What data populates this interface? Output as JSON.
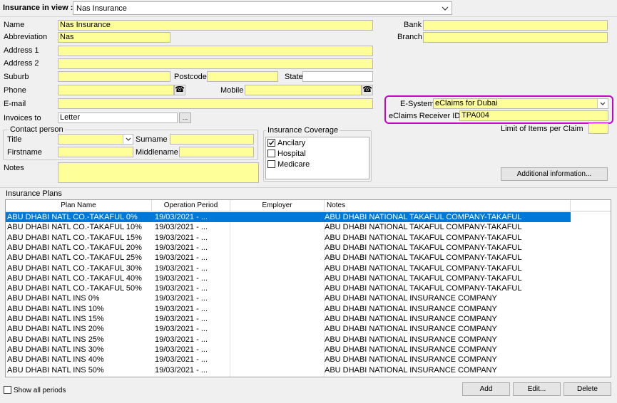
{
  "header": {
    "label": "Insurance in view :",
    "selected": "Nas Insurance"
  },
  "form": {
    "name_label": "Name",
    "name_value": "Nas Insurance",
    "abbr_label": "Abbreviation",
    "abbr_value": "Nas",
    "addr1_label": "Address 1",
    "addr2_label": "Address 2",
    "suburb_label": "Suburb",
    "postcode_label": "Postcode",
    "state_label": "State",
    "phone_label": "Phone",
    "mobile_label": "Mobile",
    "email_label": "E-mail",
    "invoices_label": "Invoices to",
    "invoices_value": "Letter",
    "invoices_btn": "...",
    "bank_label": "Bank",
    "branch_label": "Branch",
    "esystem_label": "E-System",
    "esystem_value": "eClaims for Dubai",
    "receiver_label": "eClaims Receiver ID",
    "receiver_value": "TPA004",
    "limit_label": "Limit of Items per Claim",
    "notes_label": "Notes",
    "additional_btn": "Additional information..."
  },
  "contact": {
    "title": "Contact person",
    "title_label": "Title",
    "surname_label": "Surname",
    "firstname_label": "Firstname",
    "middlename_label": "Middlename"
  },
  "coverage": {
    "title": "Insurance Coverage",
    "items": [
      {
        "label": "Ancilary",
        "checked": true
      },
      {
        "label": "Hospital",
        "checked": false
      },
      {
        "label": "Medicare",
        "checked": false
      }
    ]
  },
  "plans": {
    "title": "Insurance Plans",
    "columns": [
      "Plan Name",
      "Operation Period",
      "Employer",
      "Notes"
    ],
    "rows": [
      {
        "name": "ABU DHABI NATL CO.-TAKAFUL 0%",
        "period": "19/03/2021 - ...",
        "employer": "",
        "notes": "ABU DHABI NATIONAL TAKAFUL COMPANY-TAKAFUL"
      },
      {
        "name": "ABU DHABI NATL CO.-TAKAFUL 10%",
        "period": "19/03/2021 - ...",
        "employer": "",
        "notes": "ABU DHABI NATIONAL TAKAFUL COMPANY-TAKAFUL"
      },
      {
        "name": "ABU DHABI NATL CO.-TAKAFUL 15%",
        "period": "19/03/2021 - ...",
        "employer": "",
        "notes": "ABU DHABI NATIONAL TAKAFUL COMPANY-TAKAFUL"
      },
      {
        "name": "ABU DHABI NATL CO.-TAKAFUL 20%",
        "period": "19/03/2021 - ...",
        "employer": "",
        "notes": "ABU DHABI NATIONAL TAKAFUL COMPANY-TAKAFUL"
      },
      {
        "name": "ABU DHABI NATL CO.-TAKAFUL 25%",
        "period": "19/03/2021 - ...",
        "employer": "",
        "notes": "ABU DHABI NATIONAL TAKAFUL COMPANY-TAKAFUL"
      },
      {
        "name": "ABU DHABI NATL CO.-TAKAFUL 30%",
        "period": "19/03/2021 - ...",
        "employer": "",
        "notes": "ABU DHABI NATIONAL TAKAFUL COMPANY-TAKAFUL"
      },
      {
        "name": "ABU DHABI NATL CO.-TAKAFUL 40%",
        "period": "19/03/2021 - ...",
        "employer": "",
        "notes": "ABU DHABI NATIONAL TAKAFUL COMPANY-TAKAFUL"
      },
      {
        "name": "ABU DHABI NATL CO.-TAKAFUL 50%",
        "period": "19/03/2021 - ...",
        "employer": "",
        "notes": "ABU DHABI NATIONAL TAKAFUL COMPANY-TAKAFUL"
      },
      {
        "name": "ABU DHABI NATL INS 0%",
        "period": "19/03/2021 - ...",
        "employer": "",
        "notes": "ABU DHABI NATIONAL INSURANCE COMPANY"
      },
      {
        "name": "ABU DHABI NATL INS 10%",
        "period": "19/03/2021 - ...",
        "employer": "",
        "notes": "ABU DHABI NATIONAL INSURANCE COMPANY"
      },
      {
        "name": "ABU DHABI NATL INS 15%",
        "period": "19/03/2021 - ...",
        "employer": "",
        "notes": "ABU DHABI NATIONAL INSURANCE COMPANY"
      },
      {
        "name": "ABU DHABI NATL INS 20%",
        "period": "19/03/2021 - ...",
        "employer": "",
        "notes": "ABU DHABI NATIONAL INSURANCE COMPANY"
      },
      {
        "name": "ABU DHABI NATL INS 25%",
        "period": "19/03/2021 - ...",
        "employer": "",
        "notes": "ABU DHABI NATIONAL INSURANCE COMPANY"
      },
      {
        "name": "ABU DHABI NATL INS 30%",
        "period": "19/03/2021 - ...",
        "employer": "",
        "notes": "ABU DHABI NATIONAL INSURANCE COMPANY"
      },
      {
        "name": "ABU DHABI NATL INS 40%",
        "period": "19/03/2021 - ...",
        "employer": "",
        "notes": "ABU DHABI NATIONAL INSURANCE COMPANY"
      },
      {
        "name": "ABU DHABI NATL INS 50%",
        "period": "19/03/2021 - ...",
        "employer": "",
        "notes": "ABU DHABI NATIONAL INSURANCE COMPANY"
      }
    ]
  },
  "footer": {
    "show_all_label": "Show all periods",
    "add_btn": "Add",
    "edit_btn": "Edit...",
    "delete_btn": "Delete"
  },
  "colors": {
    "field_bg": "#ffff99",
    "selection": "#0078d7",
    "highlight": "#cc00cc"
  }
}
